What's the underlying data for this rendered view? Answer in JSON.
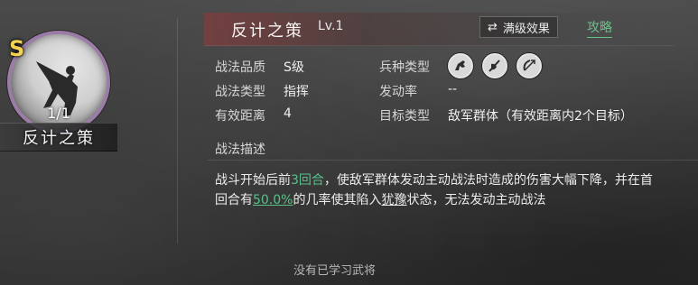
{
  "left_card": {
    "grade": "S",
    "count": "1/1",
    "name": "反计之策"
  },
  "header": {
    "title": "反计之策",
    "level": "Lv.1",
    "max_effect_label": "满级效果",
    "strategy_label": "攻略"
  },
  "attributes": {
    "quality_label": "战法品质",
    "quality_value": "S级",
    "type_label": "战法类型",
    "type_value": "指挥",
    "range_label": "有效距离",
    "range_value": "4",
    "troop_label": "兵种类型",
    "troop_icons": [
      "horse-icon",
      "shield-spear-icon",
      "bow-icon"
    ],
    "rate_label": "发动率",
    "rate_value": "--",
    "target_label": "目标类型",
    "target_value": "敌军群体（有效距离内2个目标）"
  },
  "description": {
    "title": "战法描述",
    "line1_a": "战斗开始后前",
    "line1_hl": "3回合",
    "line1_b": "，使敌军群体发动主动战法时造成的伤害大幅下降，并在首",
    "line2_a": "回合有",
    "line2_hl": "50.0%",
    "line2_b": "的几率使其陷入",
    "line2_ul": "犹豫",
    "line2_c": "状态，无法发动主动战法"
  },
  "footer": {
    "note": "没有已学习武将"
  },
  "colors": {
    "accent_green": "#58c189",
    "grade_gold": "#f3d24f",
    "banner_red": "#7a3e3e",
    "portrait_ring": "#9b7ca6"
  }
}
